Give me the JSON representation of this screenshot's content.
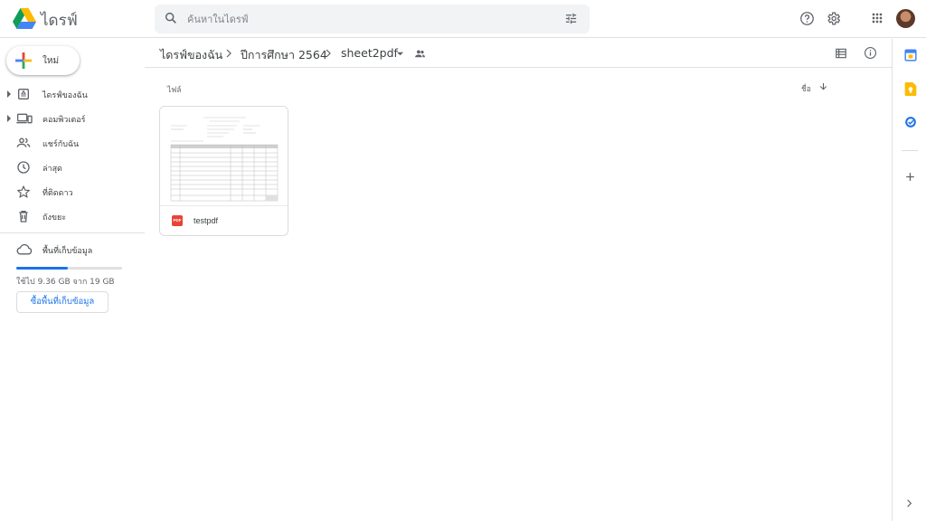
{
  "header": {
    "app_title": "ไดรฟ์",
    "search_placeholder": "ค้นหาในไดรฟ์"
  },
  "sidebar": {
    "new_label": "ใหม่",
    "items": [
      {
        "label": "ไดรฟ์ของฉัน",
        "icon": "my-drive-icon"
      },
      {
        "label": "คอมพิวเตอร์",
        "icon": "computer-icon"
      },
      {
        "label": "แชร์กับฉัน",
        "icon": "shared-icon"
      },
      {
        "label": "ล่าสุด",
        "icon": "clock-icon"
      },
      {
        "label": "ที่ติดดาว",
        "icon": "star-icon"
      },
      {
        "label": "ถังขยะ",
        "icon": "trash-icon"
      }
    ],
    "storage_label": "พื้นที่เก็บข้อมูล",
    "storage_used_fraction": 0.49,
    "storage_text": "ใช้ไป 9.36 GB จาก 19 GB",
    "buy_storage_label": "ซื้อพื้นที่เก็บข้อมูล"
  },
  "breadcrumb": {
    "items": [
      "ไดรฟ์ของฉัน",
      "ปีการศึกษา 2564",
      "sheet2pdf"
    ]
  },
  "main": {
    "section_label": "ไฟล์",
    "sort_label": "ชื่อ",
    "files": [
      {
        "name": "testpdf",
        "type_badge": "PDF"
      }
    ]
  },
  "colors": {
    "accent": "#1a73e8",
    "pdf_red": "#ea4335",
    "search_bg": "#f1f3f4"
  }
}
